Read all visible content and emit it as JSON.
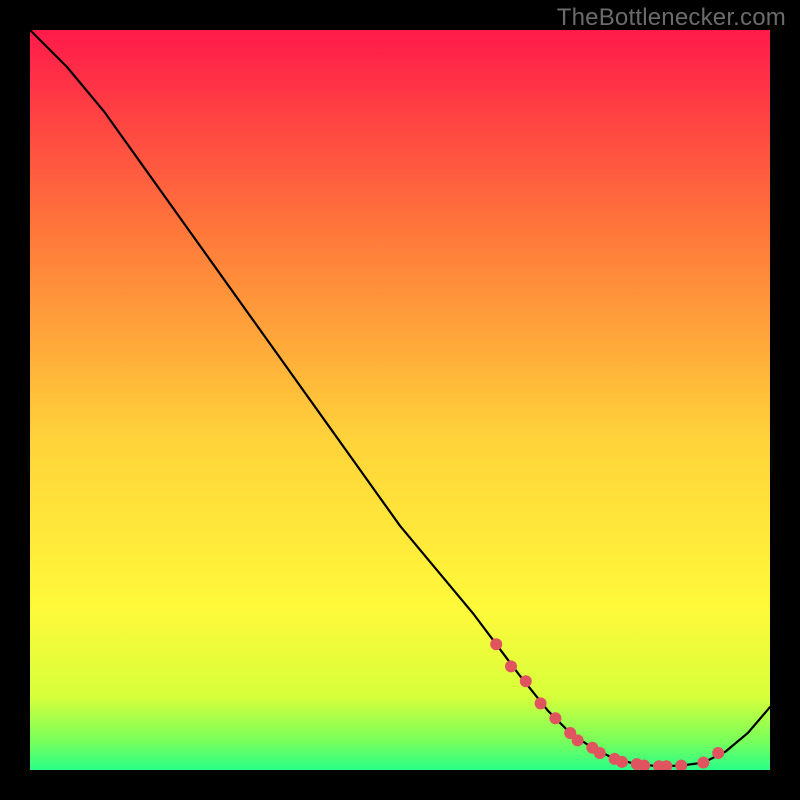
{
  "attribution": "TheBottlenecker.com",
  "colors": {
    "bg": "#000000",
    "gradient_top": "#ff1a4a",
    "gradient_mid_upper": "#ff7a3a",
    "gradient_mid": "#ffd23a",
    "gradient_mid_lower": "#fff93a",
    "gradient_green1": "#d7ff3a",
    "gradient_green2": "#7aff5a",
    "gradient_green3": "#29ff88",
    "curve": "#000000",
    "marker": "#e0545f"
  },
  "chart_data": {
    "type": "line",
    "title": "",
    "xlabel": "",
    "ylabel": "",
    "xlim": [
      0,
      100
    ],
    "ylim": [
      0,
      100
    ],
    "series": [
      {
        "name": "curve",
        "x": [
          0,
          5,
          10,
          15,
          20,
          25,
          30,
          35,
          40,
          45,
          50,
          55,
          60,
          63,
          66,
          70,
          73,
          76,
          79,
          82,
          85,
          88,
          91,
          94,
          97,
          100
        ],
        "y": [
          100,
          95,
          89,
          82,
          75,
          68,
          61,
          54,
          47,
          40,
          33,
          27,
          21,
          17,
          13,
          8,
          5,
          3,
          1.5,
          0.8,
          0.5,
          0.6,
          1.0,
          2.5,
          5.0,
          8.5
        ]
      }
    ],
    "markers": {
      "name": "highlight-points",
      "x": [
        63,
        65,
        67,
        69,
        71,
        73,
        74,
        76,
        77,
        79,
        80,
        82,
        83,
        85,
        86,
        88,
        91,
        93
      ],
      "y": [
        17,
        14,
        12,
        9,
        7,
        5,
        4,
        3,
        2.3,
        1.5,
        1.1,
        0.8,
        0.6,
        0.5,
        0.5,
        0.6,
        1.0,
        2.3
      ]
    }
  }
}
